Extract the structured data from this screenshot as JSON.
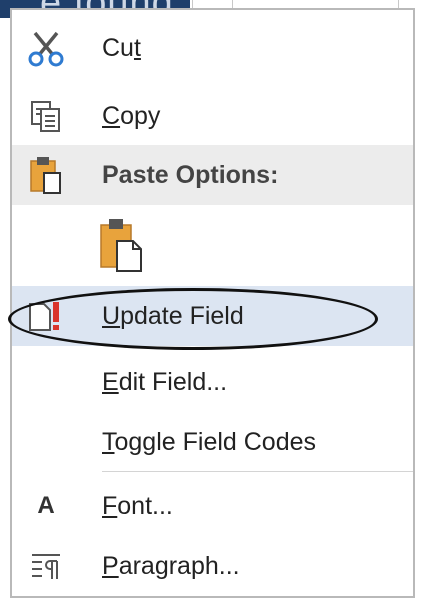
{
  "menu": {
    "items": [
      {
        "key": "cut",
        "label_pre": "Cu",
        "label_mnemonic": "t",
        "label_post": "",
        "icon": "scissors-icon"
      },
      {
        "key": "copy",
        "label_pre": "",
        "label_mnemonic": "C",
        "label_post": "opy",
        "icon": "copy-icon"
      },
      {
        "key": "paste_options",
        "label": "Paste Options:",
        "icon": "clipboard-icon"
      },
      {
        "key": "paste_keep",
        "icon": "clipboard-paste-icon"
      },
      {
        "key": "update_field",
        "label_pre": "",
        "label_mnemonic": "U",
        "label_post": "pdate Field",
        "icon": "update-field-icon"
      },
      {
        "key": "edit_field",
        "label_pre": "",
        "label_mnemonic": "E",
        "label_post": "dit Field...",
        "icon": ""
      },
      {
        "key": "toggle_codes",
        "label_pre": "",
        "label_mnemonic": "T",
        "label_post": "oggle Field Codes",
        "icon": ""
      },
      {
        "key": "font",
        "label_pre": "",
        "label_mnemonic": "F",
        "label_post": "ont...",
        "icon": "font-icon",
        "icon_glyph": "A"
      },
      {
        "key": "paragraph",
        "label_pre": "",
        "label_mnemonic": "P",
        "label_post": "aragraph...",
        "icon": "paragraph-icon"
      }
    ],
    "highlight_color": "#dce5f2",
    "header_color": "#ececec",
    "accent_icon_color": "#e8a33c"
  },
  "background": {
    "doc_text_fragment": "e found"
  }
}
